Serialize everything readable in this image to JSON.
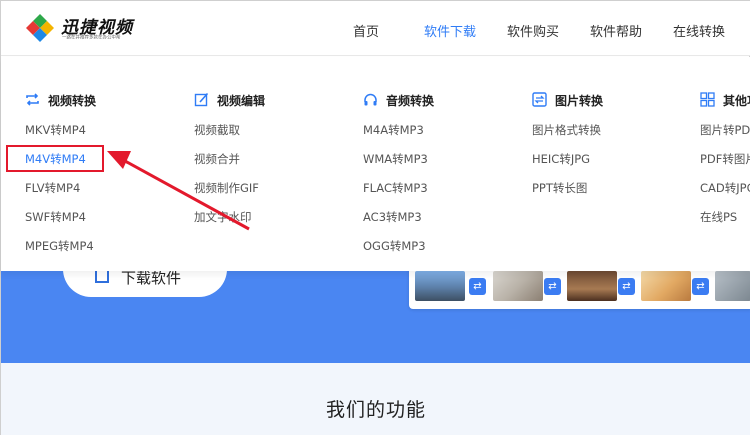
{
  "header": {
    "logo_title": "迅捷视频",
    "logo_subtitle": "一路在并推荐多款在办公中帮",
    "nav": [
      {
        "label": "首页"
      },
      {
        "label": "软件下载"
      },
      {
        "label": "软件购买"
      },
      {
        "label": "软件帮助"
      },
      {
        "label": "在线转换"
      }
    ],
    "active_nav": "软件下载"
  },
  "dropdown": {
    "columns": [
      {
        "title": "视频转换",
        "icon": "loop-icon",
        "items": [
          "MKV转MP4",
          "M4V转MP4",
          "FLV转MP4",
          "SWF转MP4",
          "MPEG转MP4"
        ]
      },
      {
        "title": "视频编辑",
        "icon": "edit-icon",
        "items": [
          "视频截取",
          "视频合并",
          "视频制作GIF",
          "加文字水印"
        ]
      },
      {
        "title": "音频转换",
        "icon": "headphones-icon",
        "items": [
          "M4A转MP3",
          "WMA转MP3",
          "FLAC转MP3",
          "AC3转MP3",
          "OGG转MP3"
        ]
      },
      {
        "title": "图片转换",
        "icon": "image-swap-icon",
        "items": [
          "图片格式转换",
          "HEIC转JPG",
          "PPT转长图"
        ]
      },
      {
        "title": "其他功",
        "icon": "grid-icon",
        "items": [
          "图片转PDF",
          "PDF转图片",
          "CAD转JPG",
          "在线PS"
        ]
      }
    ],
    "highlighted_item": "M4V转MP4"
  },
  "banner": {
    "download_label": "下载软件"
  },
  "features": {
    "title": "我们的功能"
  },
  "colors": {
    "accent": "#2f7cf6",
    "banner": "#4a86f2",
    "highlight_border": "#e3192c"
  }
}
